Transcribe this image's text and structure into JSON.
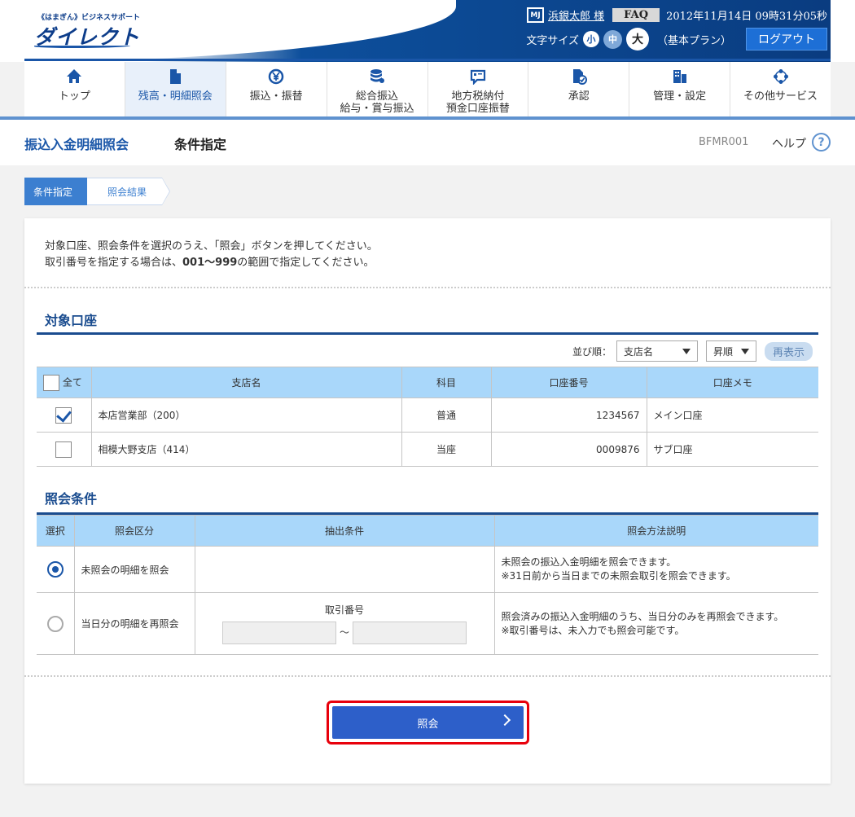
{
  "header": {
    "logo_small": "《はまぎん》ビジネスサポート",
    "logo_big": "ダイレクト",
    "badge": "MJ",
    "user": "浜銀太郎 様",
    "faq": "FAQ",
    "datetime": "2012年11月14日 09時31分05秒",
    "font_size_label": "文字サイズ",
    "font_sizes": [
      "小",
      "中",
      "大"
    ],
    "plan": "（基本プラン）",
    "logout": "ログアウト"
  },
  "nav": [
    {
      "label": "トップ",
      "icon": "home-icon"
    },
    {
      "label": "残高・明細照会",
      "icon": "document-icon"
    },
    {
      "label": "振込・振替",
      "icon": "yen-transfer-icon"
    },
    {
      "label": "総合振込\n給与・賞与振込",
      "icon": "database-icon"
    },
    {
      "label": "地方税納付\n預金口座振替",
      "icon": "card-icon"
    },
    {
      "label": "承認",
      "icon": "approve-icon"
    },
    {
      "label": "管理・設定",
      "icon": "manage-icon"
    },
    {
      "label": "その他サービス",
      "icon": "other-icon"
    }
  ],
  "page": {
    "title": "振込入金明細照会",
    "subtitle": "条件指定",
    "screen_id": "BFMR001",
    "help": "ヘルプ",
    "help_icon": "?"
  },
  "steps": [
    "条件指定",
    "照会結果"
  ],
  "intro": {
    "line1": "対象口座、照会条件を選択のうえ、「照会」ボタンを押してください。",
    "line2_pre": "取引番号を指定する場合は、",
    "line2_bold": "001〜999",
    "line2_post": "の範囲で指定してください。"
  },
  "accounts": {
    "section_title": "対象口座",
    "sort_label": "並び順：",
    "sort_field": "支店名",
    "sort_order": "昇順",
    "redisplay": "再表示",
    "headers": [
      "全て",
      "支店名",
      "科目",
      "口座番号",
      "口座メモ"
    ],
    "rows": [
      {
        "checked": true,
        "branch": "本店営業部（200）",
        "type": "普通",
        "number": "1234567",
        "memo": "メイン口座"
      },
      {
        "checked": false,
        "branch": "相模大野支店（414）",
        "type": "当座",
        "number": "0009876",
        "memo": "サブ口座"
      }
    ]
  },
  "conditions": {
    "section_title": "照会条件",
    "headers": [
      "選択",
      "照会区分",
      "抽出条件",
      "照会方法説明"
    ],
    "rows": [
      {
        "selected": true,
        "category": "未照会の明細を照会",
        "extract_label": "",
        "desc1": "未照会の振込入金明細を照会できます。",
        "desc2": "※31日前から当日までの未照会取引を照会できます。"
      },
      {
        "selected": false,
        "category": "当日分の明細を再照会",
        "extract_label": "取引番号",
        "range_sep": "〜",
        "desc1": "照会済みの振込入金明細のうち、当日分のみを再照会できます。",
        "desc2": "※取引番号は、未入力でも照会可能です。"
      }
    ]
  },
  "submit": {
    "label": "照会"
  }
}
